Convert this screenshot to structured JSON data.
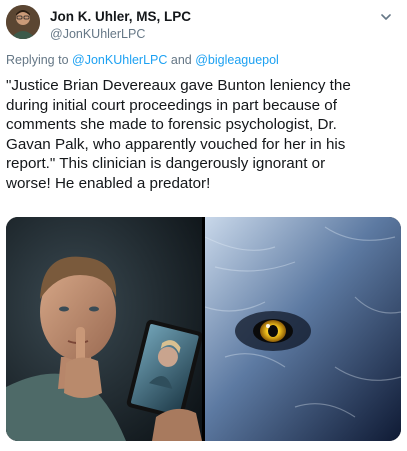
{
  "tweet": {
    "author_name": "Jon K. Uhler, MS, LPC",
    "author_handle": "@JonKUhlerLPC",
    "replying_prefix": "Replying to",
    "reply_to": [
      "@JonKUhlerLPC",
      "@bigleaguepol"
    ],
    "reply_joiner": "and",
    "text_lines": [
      "\"Justice Brian Devereaux gave Bunton leniency the",
      "during initial court proceedings in part because of",
      "comments she made to forensic psychologist, Dr.",
      "Gavan Palk, who apparently vouched for her in his",
      "report.\" This clinician is dangerously ignorant or",
      "worse! He enabled a predator!"
    ],
    "media": [
      {
        "icon": "man-with-tablet-photo"
      },
      {
        "icon": "wolf-eye-photo"
      }
    ]
  },
  "colors": {
    "link": "#1da1f2",
    "secondary_text": "#657786",
    "primary_text": "#14171a"
  }
}
